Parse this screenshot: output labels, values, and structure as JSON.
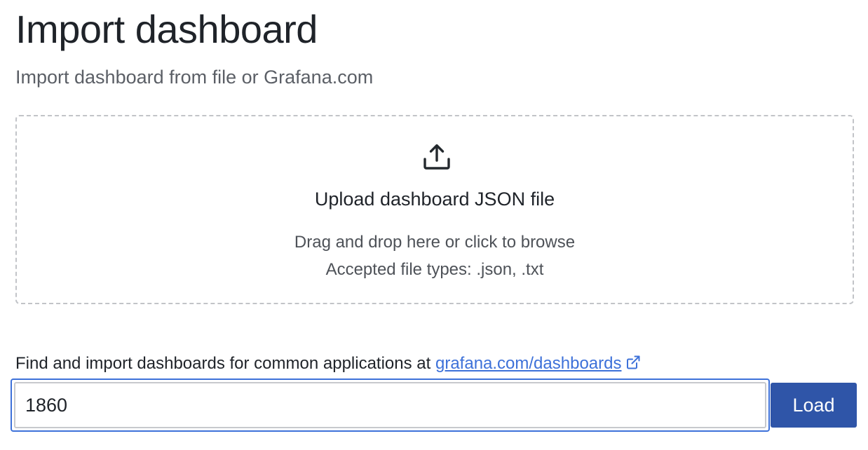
{
  "header": {
    "title": "Import dashboard",
    "subtitle": "Import dashboard from file or Grafana.com"
  },
  "dropzone": {
    "icon": "upload-icon",
    "title": "Upload dashboard JSON file",
    "hint": "Drag and drop here or click to browse",
    "accepted_types": "Accepted file types: .json, .txt"
  },
  "grafana_import": {
    "label": "Find and import dashboards for common applications at ",
    "link_text": "grafana.com/dashboards",
    "link_icon": "external-link-icon",
    "input_value": "1860",
    "load_label": "Load"
  },
  "colors": {
    "accent": "#3d71d9",
    "button": "#2f55a8"
  }
}
